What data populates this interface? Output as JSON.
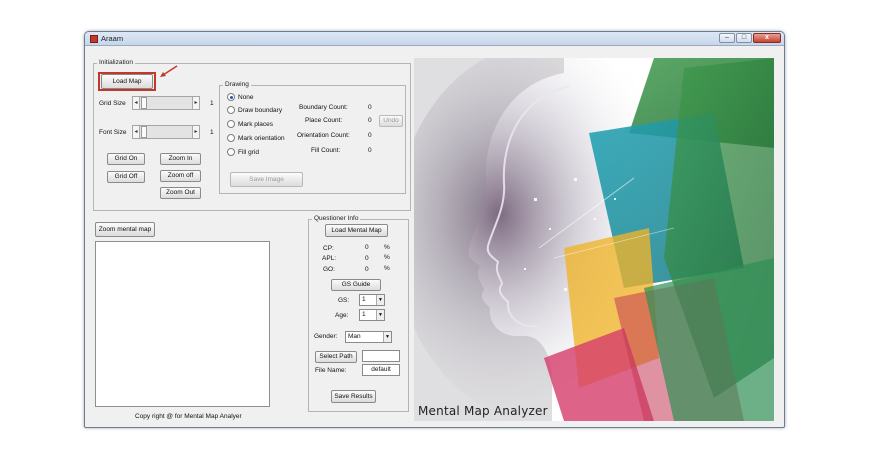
{
  "window": {
    "title": "Araam",
    "controls": {
      "minimize": "–",
      "maximize": "□",
      "close": "x"
    }
  },
  "initialization": {
    "title": "Initialization",
    "load_map": "Load Map",
    "grid_size_label": "Grid Size",
    "grid_size_value": "1",
    "font_size_label": "Font Size",
    "font_size_value": "1",
    "grid_on": "Grid On",
    "grid_off": "Grid Off",
    "zoom_in": "Zoom In",
    "zoom_off": "Zoom off",
    "zoom_out": "Zoom Out"
  },
  "drawing": {
    "title": "Drawing",
    "options": [
      "None",
      "Draw boundary",
      "Mark places",
      "Mark orientation",
      "Fill grid"
    ],
    "selected": "None",
    "counts": [
      {
        "label": "Boundary Count:",
        "value": "0"
      },
      {
        "label": "Place Count:",
        "value": "0"
      },
      {
        "label": "Orientation Count:",
        "value": "0"
      },
      {
        "label": "Fill Count:",
        "value": "0"
      }
    ],
    "undo": "Undo",
    "save_image": "Save Image"
  },
  "mental_map": {
    "zoom_button": "Zoom mental map"
  },
  "questioner": {
    "title": "Questioner Info",
    "load_mental_map": "Load Mental Map",
    "metrics": [
      {
        "label": "CP:",
        "value": "0",
        "unit": "%"
      },
      {
        "label": "APL:",
        "value": "0",
        "unit": "%"
      },
      {
        "label": "GO:",
        "value": "0",
        "unit": "%"
      }
    ],
    "gs_guide": "GS Guide",
    "gs_label": "GS:",
    "gs_value": "1",
    "age_label": "Age:",
    "age_value": "1",
    "gender_label": "Gender:",
    "gender_value": "Man",
    "select_path": "Select Path",
    "path_value": "",
    "file_name_label": "File Name:",
    "file_name_value": "default",
    "save_results": "Save Results"
  },
  "footer": {
    "copyright": "Copy right @ for Mental Map Analyer"
  },
  "art": {
    "caption": "Mental Map Analyzer"
  },
  "colors": {
    "highlight": "#c0392b",
    "window_bg": "#f0f0f0",
    "art_teal": "#2a9d8f",
    "art_green": "#3a8f45",
    "art_yellow": "#f0b429",
    "art_pink": "#d63c6b"
  },
  "icons": {
    "app": "app-icon",
    "pointer": "red-arrow-icon"
  }
}
